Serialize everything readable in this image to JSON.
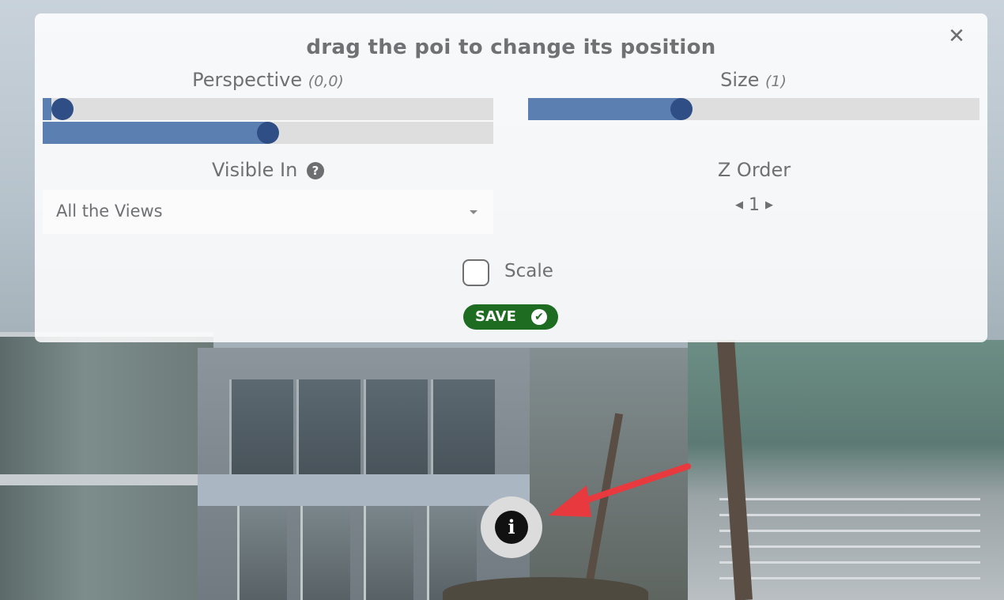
{
  "panel": {
    "title": "drag the poi to change its position",
    "close_glyph": "✕",
    "perspective": {
      "label": "Perspective",
      "hint": "(0,0)",
      "x_value": 0.02,
      "y_value": 0.5
    },
    "size": {
      "label": "Size",
      "hint": "(1)",
      "value": 0.34
    },
    "visible_in": {
      "label": "Visible In",
      "help_glyph": "?",
      "selected": "All the Views"
    },
    "z_order": {
      "label": "Z Order",
      "value": "1",
      "prev_glyph": "◀",
      "next_glyph": "▶"
    },
    "scale": {
      "label": "Scale",
      "checked": false
    },
    "save": {
      "label": "SAVE",
      "check_glyph": "✔"
    }
  },
  "poi": {
    "glyph": "i",
    "icon": "info-icon"
  },
  "colors": {
    "slider_knob": "#2f4e86",
    "slider_fill": "#5c7fb2",
    "save_button": "#1e6b22",
    "arrow": "#e8393f"
  }
}
